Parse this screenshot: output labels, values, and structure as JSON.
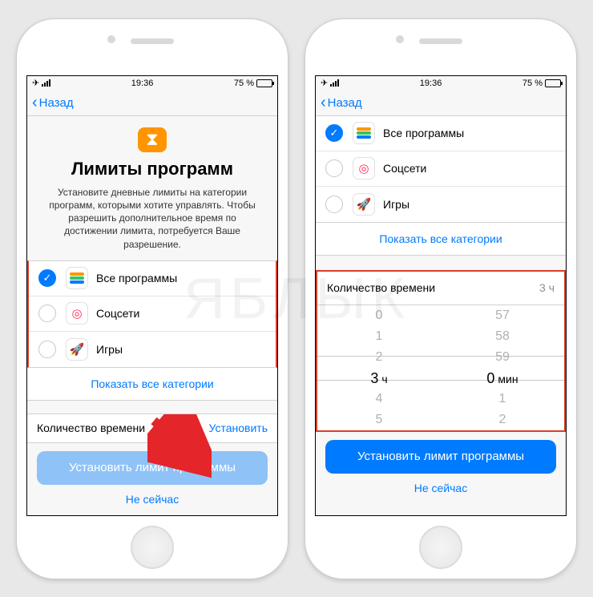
{
  "status": {
    "time": "19:36",
    "battery": "75 %"
  },
  "nav": {
    "back": "Назад"
  },
  "screen1": {
    "title": "Лимиты программ",
    "description": "Установите дневные лимиты на категории программ, которыми хотите управлять. Чтобы разрешить дополнительное время по достижении лимита, потребуется Ваше разрешение.",
    "categories": {
      "all": "Все программы",
      "social": "Соцсети",
      "games": "Игры"
    },
    "show_all": "Показать все категории",
    "time_label": "Количество времени",
    "set_link": "Установить",
    "primary": "Установить лимит программы",
    "secondary": "Не сейчас"
  },
  "screen2": {
    "categories": {
      "all": "Все программы",
      "social": "Соцсети",
      "games": "Игры"
    },
    "show_all": "Показать все категории",
    "time_label": "Количество времени",
    "time_value": "3 ч",
    "picker": {
      "hours": [
        "0",
        "1",
        "2",
        "3",
        "4",
        "5"
      ],
      "hours_sel": "3",
      "hours_unit": "ч",
      "mins": [
        "57",
        "58",
        "59",
        "0",
        "1",
        "2"
      ],
      "mins_sel": "0",
      "mins_unit": "мин"
    },
    "primary": "Установить лимит программы",
    "secondary": "Не сейчас"
  }
}
